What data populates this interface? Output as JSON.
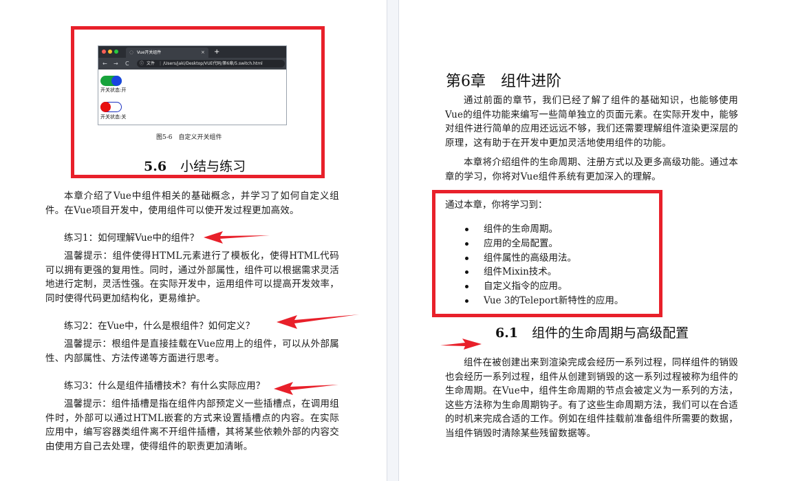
{
  "left": {
    "browser": {
      "tab_title": "Vue开关组件",
      "tab_close": "×",
      "tab_new": "+",
      "nav_back": "←",
      "nav_forward": "→",
      "nav_reload": "C",
      "url_info": "ⓘ",
      "url_file": "文件",
      "url_sep": "|",
      "url_path": "/Users/jaki/Desktop/VUE代码/第6章/5.switch.html",
      "switch_on_label": "开关状态:开",
      "switch_off_label": "开关状态:关"
    },
    "figure_caption": "图5-6　自定义开关组件",
    "section_number": "5.6",
    "section_title": "小结与练习",
    "intro": "本章介绍了Vue中组件相关的基础概念，并学习了如何自定义组件。在Vue项目开发中，使用组件可以使开发过程更加高效。",
    "exercises": [
      {
        "question": "练习1：如何理解Vue中的组件？",
        "hint": "温馨提示：组件使得HTML元素进行了模板化，使得HTML代码可以拥有更强的复用性。同时，通过外部属性，组件可以根据需求灵活地进行定制，灵活性强。在实际开发中，运用组件可以提高开发效率，同时使得代码更加结构化，更易维护。"
      },
      {
        "question": "练习2：在Vue中，什么是根组件？如何定义？",
        "hint": "温馨提示：根组件是直接挂载在Vue应用上的组件，可以从外部属性、内部属性、方法传递等方面进行思考。"
      },
      {
        "question": "练习3：什么是组件插槽技术？有什么实际应用？",
        "hint": "温馨提示：组件插槽是指在组件内部预定义一些插槽点，在调用组件时，外部可以通过HTML嵌套的方式来设置插槽点的内容。在实际应用中，编写容器类组件离不开组件插槽，其将某些依赖外部的内容交由使用方自己去处理，使得组件的职责更加清晰。"
      }
    ]
  },
  "right": {
    "chapter_title": "第6章　组件进阶",
    "intro_paragraphs": [
      "通过前面的章节，我们已经了解了组件的基础知识，也能够使用Vue的组件功能来编写一些简单独立的页面元素。在实际开发中，能够对组件进行简单的应用还远远不够，我们还需要理解组件渲染更深层的原理，这有助于在开发中更加灵活地使用组件的功能。",
      "本章将介绍组件的生命周期、注册方式以及更多高级功能。通过本章的学习，你将对Vue组件系统有更加深入的理解。"
    ],
    "learn_heading": "通过本章，你将学习到：",
    "learn_items": [
      "组件的生命周期。",
      "应用的全局配置。",
      "组件属性的高级用法。",
      "组件Mixin技术。",
      "自定义指令的应用。",
      "Vue 3的Teleport新特性的应用。"
    ],
    "section_number": "6.1",
    "section_title": "组件的生命周期与高级配置",
    "section_paragraph": "组件在被创建出来到渲染完成会经历一系列过程，同样组件的销毁也会经历一系列过程，组件从创建到销毁的这一系列过程被称为组件的生命周期。在Vue中，组件生命周期的节点会被定义为一系列的方法，这些方法称为生命周期钩子。有了这些生命周期方法，我们可以在合适的时机来完成合适的工作。例如在组件挂载前准备组件所需要的数据，当组件销毁时清除某些残留数据等。"
  },
  "colors": {
    "annotation_red": "#e8202a",
    "switch_on_track": "#17a33b",
    "switch_on_knob": "#1a45e0",
    "switch_off_knob": "#e81010"
  }
}
